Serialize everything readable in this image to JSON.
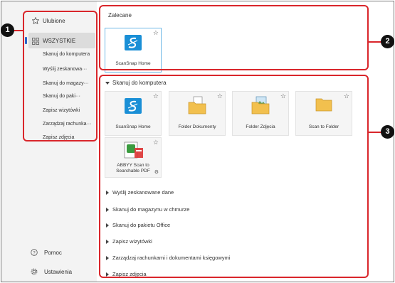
{
  "sidebar": {
    "favorites_label": "Ulubione",
    "all_label": "WSZYSTKIE",
    "items": [
      {
        "label": "Skanuj do komputera"
      },
      {
        "label": "Wyślij zeskanowa···"
      },
      {
        "label": "Skanuj do magazy···"
      },
      {
        "label": "Skanuj do paki···"
      },
      {
        "label": "Zapisz wizytówki"
      },
      {
        "label": "Zarządzaj rachunka···"
      },
      {
        "label": "Zapisz zdjęcia"
      }
    ],
    "help_label": "Pomoc",
    "settings_label": "Ustawienia"
  },
  "recommended": {
    "title": "Zalecane",
    "tile_label": "ScanSnap Home"
  },
  "scan_to_computer": {
    "title": "Skanuj do komputera",
    "tiles": [
      {
        "label": "ScanSnap Home",
        "icon": "scansnap-icon"
      },
      {
        "label": "Folder Dokumenty",
        "icon": "folder-documents-icon"
      },
      {
        "label": "Folder Zdjęcia",
        "icon": "folder-pictures-icon"
      },
      {
        "label": "Scan to Folder",
        "icon": "folder-icon"
      },
      {
        "label": "ABBYY Scan to Searchable PDF",
        "icon": "abbyy-icon"
      }
    ]
  },
  "collapsed_sections": [
    "Wyślij zeskanowane dane",
    "Skanuj do magazynu w chmurze",
    "Skanuj do pakietu Office",
    "Zapisz wizytówki",
    "Zarządzaj rachunkami i dokumentami księgowymi",
    "Zapisz zdjęcia"
  ],
  "callouts": [
    "1",
    "2",
    "3"
  ],
  "colors": {
    "callout": "#d9262b",
    "selected_tile_border": "#6fb8e6",
    "scansnap_blue": "#1a8fd6"
  }
}
